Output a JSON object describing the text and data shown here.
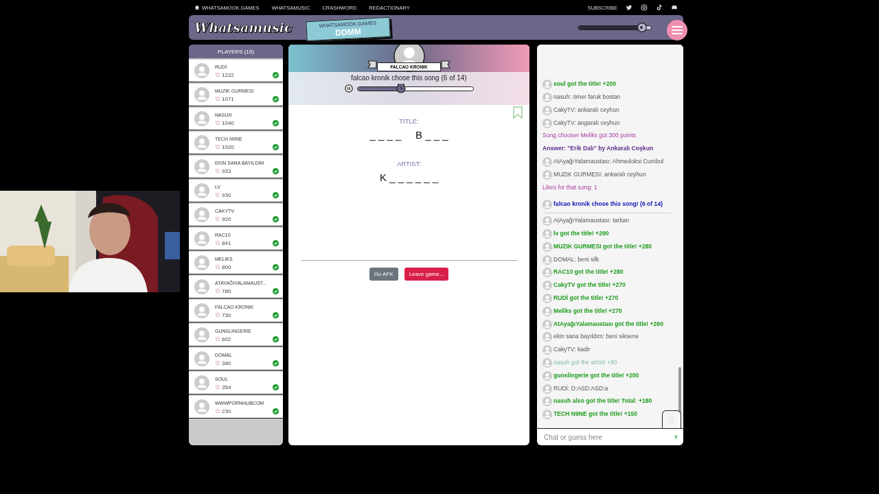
{
  "nav": {
    "links": [
      {
        "label": "WHATSAMOOK.GAMES",
        "kind": "home"
      },
      {
        "label": "WHATSAMUSIC",
        "kind": "plain"
      },
      {
        "label": "CRASHWORD",
        "kind": "plain"
      },
      {
        "label": "REDACTIONARY",
        "kind": "plain"
      }
    ],
    "subscribe": "SUBSCRIBE"
  },
  "header": {
    "logo": "Whatsamusic",
    "room_site": "WHATSAMOOK.GAMES",
    "room_code": "DDMM",
    "volume": {
      "level": 0.88
    }
  },
  "players": {
    "title": "PLAYERS (15)",
    "items": [
      {
        "name": "RUDİ",
        "score": "1222",
        "guessed": true
      },
      {
        "name": "MUZIK GURMESI",
        "score": "1071",
        "guessed": true
      },
      {
        "name": "NASUH",
        "score": "1040",
        "guessed": true
      },
      {
        "name": "TECH N9NE",
        "score": "1020",
        "guessed": true
      },
      {
        "name": "EKIN SANA BAYILDIM",
        "score": "933",
        "guessed": true
      },
      {
        "name": "LV",
        "score": "930",
        "guessed": true
      },
      {
        "name": "CAKYTV",
        "score": "920",
        "guessed": true
      },
      {
        "name": "RAC10",
        "score": "841",
        "guessed": true
      },
      {
        "name": "MELIKS",
        "score": "800",
        "guessed": true
      },
      {
        "name": "ATAYAĞIYALAMAUST...",
        "score": "780",
        "guessed": true
      },
      {
        "name": "FALCAO KRONIK",
        "score": "730",
        "guessed": true
      },
      {
        "name": "GUNSLINGERIE",
        "score": "602",
        "guessed": true
      },
      {
        "name": "DOMAL",
        "score": "380",
        "guessed": true
      },
      {
        "name": "SOUL",
        "score": "354",
        "guessed": true
      },
      {
        "name": "WWWPORNHUBCOM",
        "score": "230",
        "guessed": true
      }
    ]
  },
  "game": {
    "chooser": "FALCAO KRONIK",
    "status": "falcao kronik chose this song (6 of 14)",
    "progress": {
      "level": 0.38
    },
    "playing": true,
    "title_label": "TITLE:",
    "title_hint": "_ _ _ _     B _ _ _",
    "artist_label": "ARTIST:",
    "artist_hint": "K _ _ _ _ _ _",
    "buttons": [
      {
        "label": "Go AFK",
        "kind": "secondary"
      },
      {
        "label": "Leave game...",
        "kind": "danger"
      }
    ]
  },
  "chat": {
    "messages": [
      {
        "kind": "correct",
        "text": "soul got the title! +200"
      },
      {
        "kind": "chat",
        "text": "nasuh: ömer faruk bostan"
      },
      {
        "kind": "chat",
        "text": "CakyTV: ankaralı ceyhun"
      },
      {
        "kind": "chat",
        "text": "CakyTV: angaralı ceyhun"
      },
      {
        "kind": "system",
        "text": "Song chooser Meliks got 300 points"
      },
      {
        "kind": "answer",
        "text": "Answer: \"Erik Dalı\" by Ankaralı Coşkun"
      },
      {
        "kind": "chat",
        "text": "AtAyağıYalamaustası: Ahmedoksi Cumbul"
      },
      {
        "kind": "chat",
        "text": "MUZIK GURMESI: ankaralı ceyhun"
      },
      {
        "kind": "system",
        "text": "Likes for that song: 1"
      },
      {
        "kind": "chosen",
        "text": "falcao kronik chose this song! (6 of 14)"
      },
      {
        "kind": "chat",
        "text": "AtAyağıYalamaustası: tarkan"
      },
      {
        "kind": "correct",
        "text": "lv got the title! +290"
      },
      {
        "kind": "correct",
        "text": "MUZIK GURMESI got the title! +280"
      },
      {
        "kind": "chat",
        "text": "DOMAL: beni silk"
      },
      {
        "kind": "correct",
        "text": "RAC10 got the title! +280"
      },
      {
        "kind": "correct",
        "text": "CakyTV got the title! +270"
      },
      {
        "kind": "correct",
        "text": "RUDİ got the title! +270"
      },
      {
        "kind": "correct",
        "text": "Meliks got the title! +270"
      },
      {
        "kind": "correct",
        "text": "AtAyağıYalamaustası got the title! +260"
      },
      {
        "kind": "chat",
        "text": "ekin sana bayıldım: beni siksene"
      },
      {
        "kind": "chat",
        "text": "CakyTV: kadir"
      },
      {
        "kind": "artist",
        "text": "nasuh got the artist! +80"
      },
      {
        "kind": "correct",
        "text": "gunslingerie got the title! +200"
      },
      {
        "kind": "chat",
        "text": "RUDİ: D:ASD:ASD:a"
      },
      {
        "kind": "correct",
        "text": "nasuh also got the title! Total: +180"
      },
      {
        "kind": "correct",
        "text": "TECH N9NE got the title! +150"
      }
    ],
    "placeholder": "Chat or guess here",
    "format_key": "T"
  }
}
